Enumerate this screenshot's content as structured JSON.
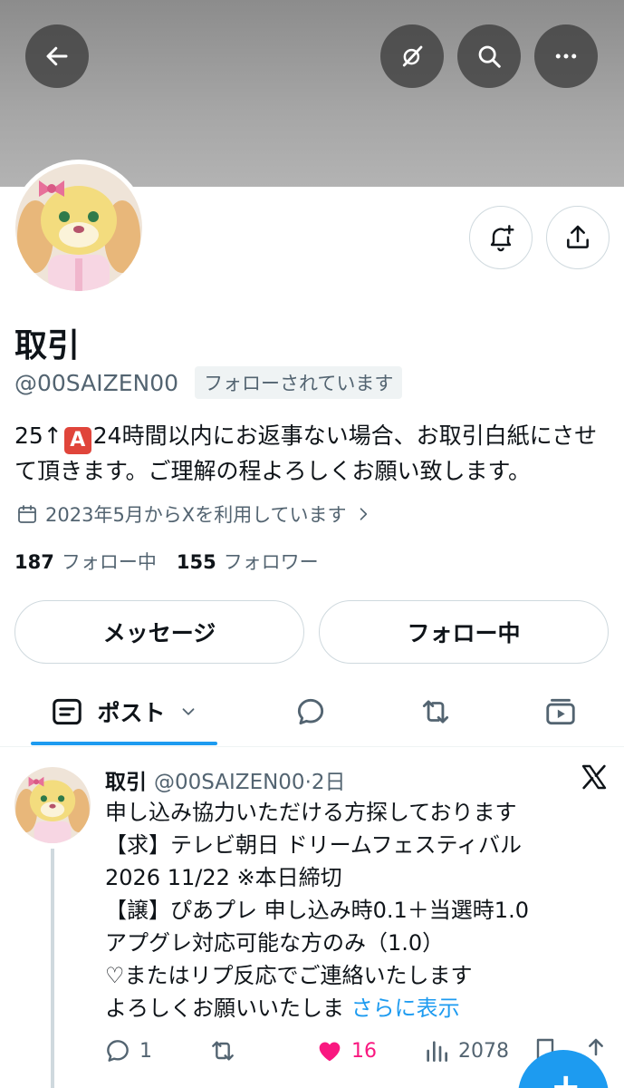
{
  "header": {
    "back_icon": "arrow-left-icon",
    "icons": [
      "grok-icon",
      "search-icon",
      "more-horizontal-icon"
    ]
  },
  "profile": {
    "name": "取引",
    "handle": "@00SAIZEN00",
    "follows_you": "フォローされています",
    "bio_before": "25↑",
    "bio_emoji": "A",
    "bio_after": "24時間以内にお返事ない場合、お取引白紙にさせて頂きます。ご理解の程よろしくお願い致します。",
    "joined": "2023年5月からXを利用しています",
    "following_count": "187",
    "following_label": "フォロー中",
    "followers_count": "155",
    "followers_label": "フォロワー"
  },
  "buttons": {
    "message": "メッセージ",
    "following": "フォロー中"
  },
  "tabs": {
    "posts_label": "ポスト"
  },
  "tweet": {
    "name": "取引",
    "meta": "@00SAIZEN00·2日",
    "lines": [
      "申し込み協力いただける方探しております",
      "【求】テレビ朝日 ドリームフェスティバル",
      "2026 11/22 ※本日締切",
      "【譲】ぴあプレ 申し込み時0.1＋当選時1.0",
      "アプグレ対応可能な方のみ（1.0）",
      "♡またはリプ反応でご連絡いたします"
    ],
    "last_line": "よろしくお願いいたしま",
    "show_more": "さらに表示",
    "replies": "1",
    "likes": "16",
    "views": "2078"
  },
  "colors": {
    "accent": "#1d9bf0",
    "like": "#f91880",
    "secondary_text": "#536471"
  }
}
